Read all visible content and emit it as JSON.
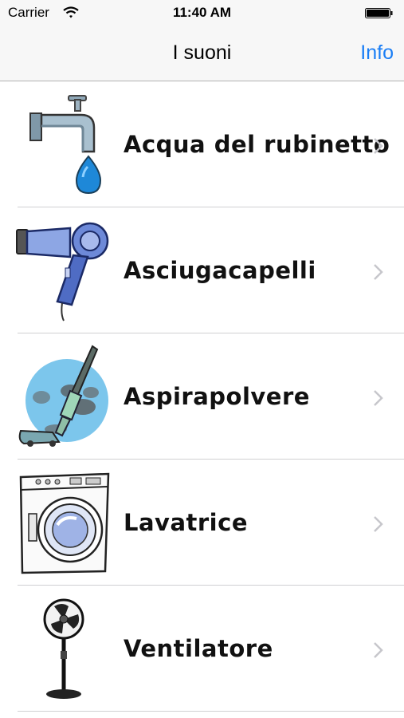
{
  "status_bar": {
    "carrier": "Carrier",
    "time": "11:40 AM",
    "wifi_icon": "wifi-icon",
    "battery_icon": "battery-icon"
  },
  "nav": {
    "title": "I suoni",
    "info_button": "Info"
  },
  "sounds": [
    {
      "label": "Acqua del rubinetto",
      "icon": "faucet-icon"
    },
    {
      "label": "Asciugacapelli",
      "icon": "hairdryer-icon"
    },
    {
      "label": "Aspirapolvere",
      "icon": "vacuum-cleaner-icon"
    },
    {
      "label": "Lavatrice",
      "icon": "washing-machine-icon"
    },
    {
      "label": "Ventilatore",
      "icon": "fan-icon"
    }
  ],
  "colors": {
    "accent": "#1a7ef5",
    "bar_background": "#f7f7f7",
    "separator": "#d0d0d2"
  }
}
